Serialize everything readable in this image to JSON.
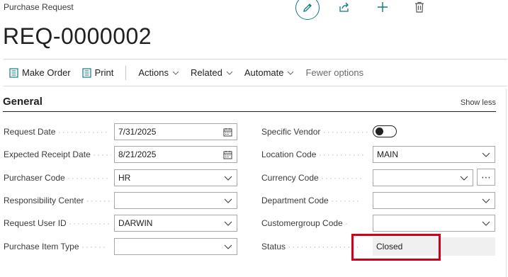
{
  "page": {
    "caption": "Purchase Request",
    "record_no": "REQ-0000002"
  },
  "top_actions": [
    {
      "name": "edit",
      "icon": "pencil-icon"
    },
    {
      "name": "share",
      "icon": "share-icon"
    },
    {
      "name": "new",
      "icon": "plus-icon"
    },
    {
      "name": "delete",
      "icon": "trash-icon"
    }
  ],
  "action_bar": {
    "make_order": "Make Order",
    "print": "Print",
    "actions": "Actions",
    "related": "Related",
    "automate": "Automate",
    "fewer_options": "Fewer options"
  },
  "general": {
    "title": "General",
    "show_less": "Show less"
  },
  "fields": {
    "request_date": {
      "label": "Request Date",
      "value": "7/31/2025"
    },
    "expected_receipt_date": {
      "label": "Expected Receipt Date",
      "value": "8/21/2025"
    },
    "purchaser_code": {
      "label": "Purchaser Code",
      "value": "HR"
    },
    "responsibility_center": {
      "label": "Responsibility Center",
      "value": ""
    },
    "request_user_id": {
      "label": "Request User ID",
      "value": "DARWIN"
    },
    "purchase_item_type": {
      "label": "Purchase Item Type",
      "value": ""
    },
    "specific_vendor": {
      "label": "Specific Vendor",
      "value": false
    },
    "location_code": {
      "label": "Location Code",
      "value": "MAIN"
    },
    "currency_code": {
      "label": "Currency Code",
      "value": ""
    },
    "department_code": {
      "label": "Department Code",
      "value": ""
    },
    "customergroup_code": {
      "label": "Customergroup Code",
      "value": ""
    },
    "status": {
      "label": "Status",
      "value": "Closed"
    }
  },
  "colors": {
    "accent": "#0f7b83",
    "highlight": "#d0021b",
    "readonly_bg": "#f0f0f0"
  }
}
